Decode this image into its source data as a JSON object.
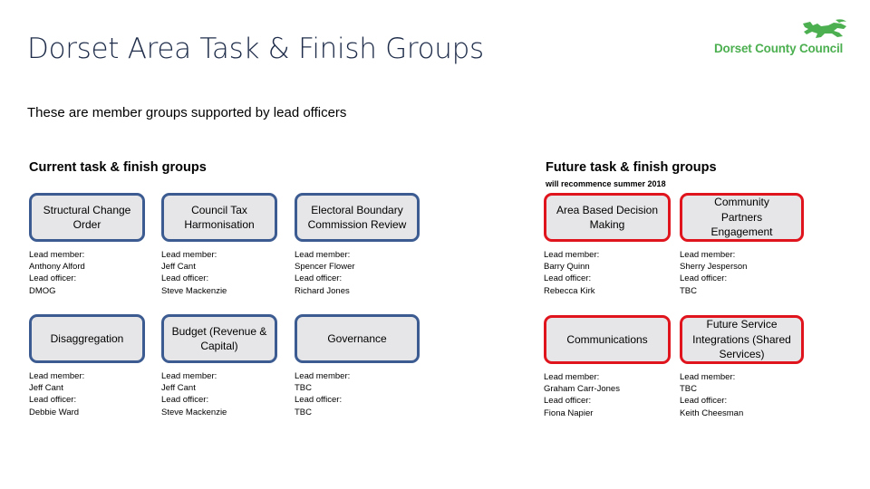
{
  "header": {
    "title": "Dorset Area Task & Finish Groups",
    "logo_text": "Dorset County Council",
    "logo_icon": "heraldic-lion-icon",
    "logo_color": "#4caf50"
  },
  "subtitle": "These are member groups supported by lead officers",
  "labels": {
    "lead_member": "Lead member:",
    "lead_officer": "Lead officer:"
  },
  "current": {
    "heading": "Current task & finish groups",
    "border_color": "#3b5b91",
    "groups": [
      {
        "name": "Structural Change Order",
        "lead_member": "Anthony Alford",
        "lead_officer": "DMOG"
      },
      {
        "name": "Council Tax Harmonisation",
        "lead_member": "Jeff Cant",
        "lead_officer": "Steve Mackenzie"
      },
      {
        "name": "Electoral Boundary Commission Review",
        "lead_member": "Spencer Flower",
        "lead_officer": "Richard Jones"
      },
      {
        "name": "Disaggregation",
        "lead_member": "Jeff Cant",
        "lead_officer": "Debbie Ward"
      },
      {
        "name": "Budget (Revenue & Capital)",
        "lead_member": "Jeff Cant",
        "lead_officer": "Steve Mackenzie"
      },
      {
        "name": "Governance",
        "lead_member": "TBC",
        "lead_officer": "TBC"
      }
    ]
  },
  "future": {
    "heading": "Future task & finish groups",
    "note": "will recommence summer 2018",
    "border_color": "#e0141c",
    "groups": [
      {
        "name": "Area Based Decision Making",
        "lead_member": "Barry Quinn",
        "lead_officer": "Rebecca Kirk"
      },
      {
        "name": "Community Partners Engagement",
        "lead_member": "Sherry Jesperson",
        "lead_officer": "TBC"
      },
      {
        "name": "Communications",
        "lead_member": "Graham Carr-Jones",
        "lead_officer": "Fiona Napier"
      },
      {
        "name": "Future Service Integrations (Shared Services)",
        "lead_member": "TBC",
        "lead_officer": "Keith Cheesman"
      }
    ]
  }
}
